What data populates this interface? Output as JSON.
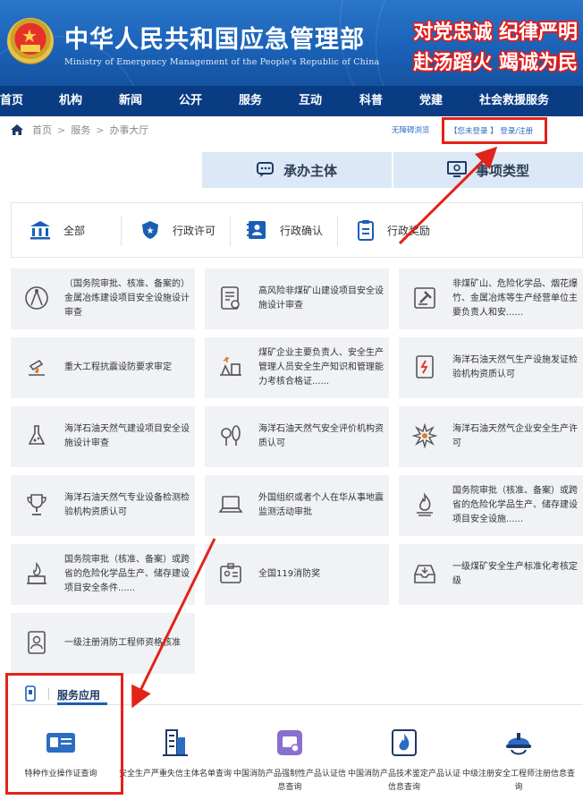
{
  "header": {
    "title_cn": "中华人民共和国应急管理部",
    "title_en": "Ministry of Emergency Management of the People's Republic of China",
    "slogan_line1": "对党忠诚 纪律严明",
    "slogan_line2": "赴汤蹈火 竭诚为民"
  },
  "nav": [
    "首页",
    "机构",
    "新闻",
    "公开",
    "服务",
    "互动",
    "科普",
    "党建",
    "社会救援服务"
  ],
  "breadcrumb": {
    "home": "首页",
    "sep": ">",
    "section": "服务",
    "page": "办事大厅"
  },
  "a11y_label": "无障碍浏览",
  "login_text": "【您未登录 】 登录/注册",
  "tabs": {
    "subject": "承办主体",
    "item_type": "事项类型"
  },
  "filters": [
    "全部",
    "行政许可",
    "行政确认",
    "行政奖励"
  ],
  "services": [
    "（国务院审批、核准、备案的）金属冶炼建设项目安全设施设计审查",
    "高风险非煤矿山建设项目安全设施设计审查",
    "非煤矿山、危险化学品、烟花爆竹、金属冶炼等生产经营单位主要负责人和安......",
    "重大工程抗震设防要求审定",
    "煤矿企业主要负责人、安全生产管理人员安全生产知识和管理能力考核合格证......",
    "海洋石油天然气生产设施发证检验机构资质认可",
    "海洋石油天然气建设项目安全设施设计审查",
    "海洋石油天然气安全评价机构资质认可",
    "海洋石油天然气企业安全生产许可",
    "海洋石油天然气专业设备检测检验机构资质认可",
    "外国组织或者个人在华从事地震监测活动审批",
    "国务院审批（核准、备案）或跨省的危险化学品生产、储存建设项目安全设施......",
    "国务院审批（核准、备案）或跨省的危险化学品生产、储存建设项目安全条件......",
    "全国119消防奖",
    "一级煤矿安全生产标准化考核定级",
    "一级注册消防工程师资格核准"
  ],
  "service_apps": {
    "title": "服务应用",
    "items": [
      "特种作业操作证查询",
      "安全生产严重失信主体名单查询",
      "中国消防产品强制性产品认证信息查询",
      "中国消防产品技术鉴定产品认证信息查询",
      "中级注册安全工程师注册信息查询"
    ]
  },
  "colors": {
    "header_blue": "#1a5fb4",
    "nav_blue": "#0a3c83",
    "tab_bg": "#dce8f5",
    "card_bg": "#f0f2f5",
    "annotation_red": "#e2231a",
    "link_blue": "#2b6cc4"
  }
}
